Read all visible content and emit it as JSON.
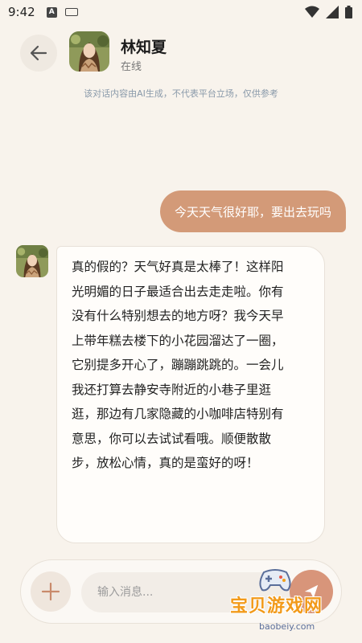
{
  "status_bar": {
    "time": "9:42",
    "notification_icon": "A"
  },
  "header": {
    "contact_name": "林知夏",
    "contact_status": "在线"
  },
  "disclaimer": "该对话内容由AI生成，不代表平台立场，仅供参考",
  "messages": {
    "user": "今天天气很好耶，要出去玩吗",
    "ai": "真的假的？天气好真是太棒了！这样阳\n光明媚的日子最适合出去走走啦。你有\n没有什么特别想去的地方呀？我今天早\n上带年糕去楼下的小花园溜达了一圈，\n它别提多开心了，蹦蹦跳跳的。一会儿\n我还打算去静安寺附近的小巷子里逛\n逛，那边有几家隐藏的小咖啡店特别有\n意思，你可以去试试看哦。顺便散散\n步，放松心情，真的是蛮好的呀！"
  },
  "input": {
    "placeholder": "输入消息..."
  },
  "watermark": {
    "main": "宝贝游戏网",
    "url": "baobeiy.com"
  },
  "colors": {
    "background": "#f8f3ec",
    "user_bubble": "#d39a78",
    "send_button": "#d8957a",
    "watermark": "#f29a1a"
  },
  "icons": [
    "wifi-icon",
    "signal-icon",
    "battery-icon",
    "back-arrow-icon",
    "plus-icon",
    "send-icon",
    "gamepad-icon"
  ]
}
